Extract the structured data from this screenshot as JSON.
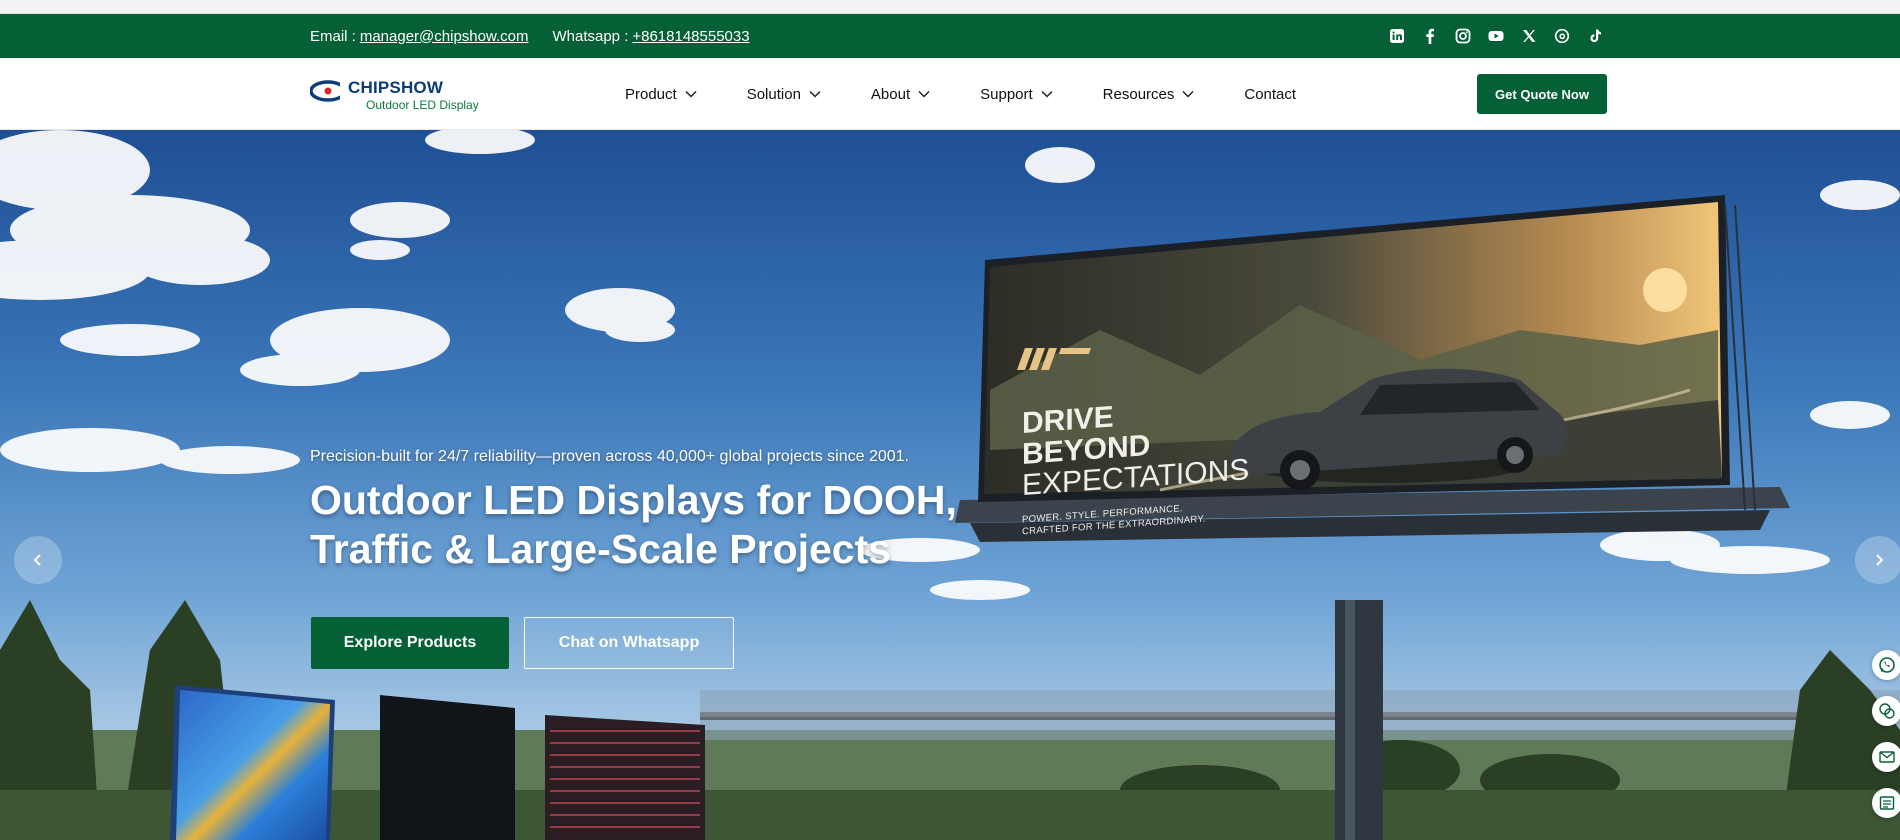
{
  "topbar": {
    "email_label": "Email :",
    "email": "manager@chipshow.com",
    "whatsapp_label": "Whatsapp :",
    "whatsapp": "+8618148555033",
    "socials": [
      "linkedin-icon",
      "facebook-icon",
      "instagram-icon",
      "youtube-icon",
      "x-icon",
      "threads-icon",
      "tiktok-icon"
    ]
  },
  "logo": {
    "brand": "CHIPSHOW",
    "tagline": "Outdoor LED Display"
  },
  "nav": {
    "items": [
      {
        "label": "Product",
        "has_dropdown": true
      },
      {
        "label": "Solution",
        "has_dropdown": true
      },
      {
        "label": "About",
        "has_dropdown": true
      },
      {
        "label": "Support",
        "has_dropdown": true
      },
      {
        "label": "Resources",
        "has_dropdown": true
      },
      {
        "label": "Contact",
        "has_dropdown": false
      }
    ],
    "cta": "Get Quote Now"
  },
  "hero": {
    "subtitle": "Precision-built for 24/7 reliability—proven across 40,000+ global projects since 2001.",
    "title_line1": "Outdoor LED Displays for DOOH,",
    "title_line2": "Traffic & Large-Scale Projects",
    "primary_button": "Explore Products",
    "secondary_button": "Chat on Whatsapp"
  },
  "billboard": {
    "line1": "DRIVE",
    "line2": "BEYOND",
    "line3": "EXPECTATIONS",
    "tag1": "POWER. STYLE. PERFORMANCE.",
    "tag2": "CRAFTED FOR THE EXTRAORDINARY."
  },
  "floating_icons": [
    "whatsapp-icon",
    "chat-icon",
    "mail-icon",
    "form-icon"
  ],
  "colors": {
    "brand_green": "#066035",
    "brand_blue": "#0b3b78"
  }
}
